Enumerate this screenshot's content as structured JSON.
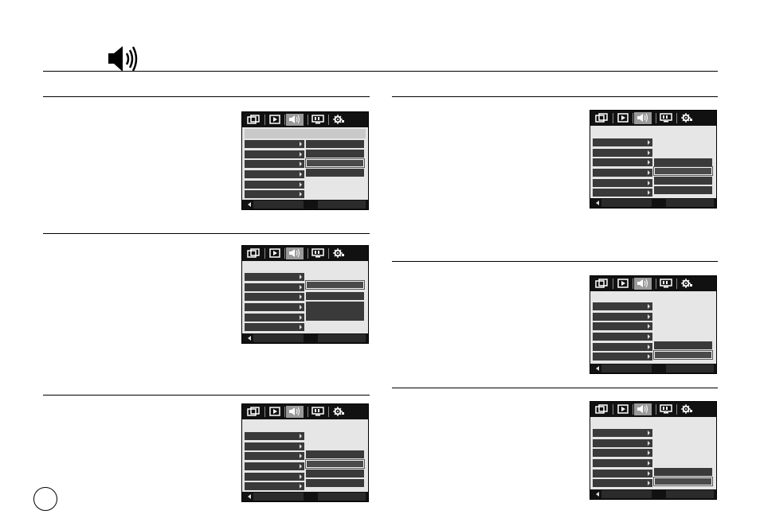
{
  "header": {
    "icon": "speaker-icon"
  },
  "footer": {
    "icon": "page-number-circle"
  },
  "colors": {
    "rule": "#000000",
    "lcd_bar": "#111111",
    "lcd_item": "#3a3a3a",
    "lcd_bg": "#e6e6e6",
    "active_tab": "#9a9a9a"
  },
  "lcd_tabs": [
    "record-mode-icon",
    "playback-icon",
    "sound-icon",
    "display-icon",
    "settings-icon"
  ],
  "screens": [
    {
      "name": "lcd-screen-1",
      "active_tab": "sound-icon",
      "selected_option": 3
    },
    {
      "name": "lcd-screen-2",
      "active_tab": "sound-icon",
      "selected_option": 1
    },
    {
      "name": "lcd-screen-3",
      "active_tab": "sound-icon",
      "selected_option": 2
    },
    {
      "name": "lcd-screen-4",
      "active_tab": "sound-icon",
      "selected_option": 2
    },
    {
      "name": "lcd-screen-5",
      "active_tab": "sound-icon",
      "selected_option": 2
    },
    {
      "name": "lcd-screen-6",
      "active_tab": "sound-icon",
      "selected_option": 2
    }
  ]
}
